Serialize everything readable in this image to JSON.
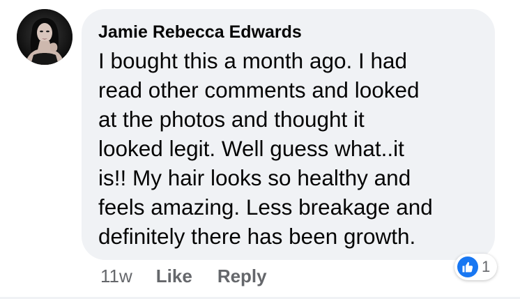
{
  "comment": {
    "author": "Jamie Rebecca Edwards",
    "text": "I bought this a month ago. I had\nread other comments and looked\nat the photos and thought it\nlooked legit. Well guess what..it\nis!! My hair looks so healthy and\nfeels amazing. Less breakage and\ndefinitely there has been growth.",
    "timestamp": "11w",
    "like_label": "Like",
    "reply_label": "Reply",
    "reaction_count": "1",
    "reaction_icon": "thumbs-up-icon"
  },
  "colors": {
    "bubble_background": "#f0f2f5",
    "text_primary": "#050505",
    "text_secondary": "#65676b",
    "like_blue": "#1877f2"
  }
}
